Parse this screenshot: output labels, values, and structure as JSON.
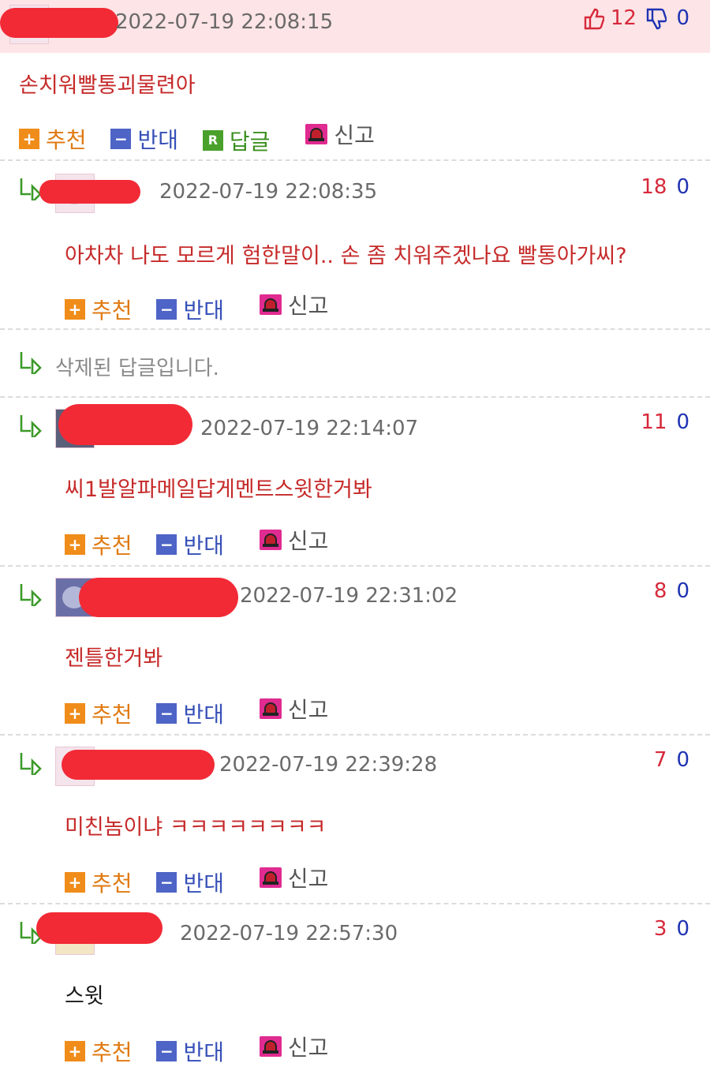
{
  "top": {
    "date": "2022-07-19 22:08:15",
    "up": "12",
    "down": "0",
    "text": "손치워빨통괴물련아",
    "actions": {
      "recommend": "추천",
      "oppose": "반대",
      "reply": "답글",
      "report": "신고"
    }
  },
  "replies": [
    {
      "date": "2022-07-19 22:08:35",
      "up": "18",
      "down": "0",
      "text": "아차차 나도 모르게 험한말이.. 손 좀 치워주겠나요 빨통아가씨?",
      "recommend": "추천",
      "oppose": "반대",
      "report": "신고"
    },
    {
      "deleted_text": "삭제된 답글입니다."
    },
    {
      "date": "2022-07-19 22:14:07",
      "up": "11",
      "down": "0",
      "text": "씨1발알파메일답게멘트스윗한거봐",
      "recommend": "추천",
      "oppose": "반대",
      "report": "신고"
    },
    {
      "date": "2022-07-19 22:31:02",
      "up": "8",
      "down": "0",
      "text": "젠틀한거봐",
      "recommend": "추천",
      "oppose": "반대",
      "report": "신고"
    },
    {
      "date": "2022-07-19 22:39:28",
      "up": "7",
      "down": "0",
      "text": "미친놈이냐 ㅋㅋㅋㅋㅋㅋㅋㅋ",
      "recommend": "추천",
      "oppose": "반대",
      "report": "신고"
    },
    {
      "date": "2022-07-19 22:57:30",
      "up": "3",
      "down": "0",
      "text": "스윗",
      "recommend": "추천",
      "oppose": "반대",
      "report": "신고"
    }
  ],
  "colors": {
    "header_bg": "#fde4e6",
    "text_red": "#c62a2a",
    "up_red": "#d6293a",
    "down_blue": "#1f33b3",
    "redaction": "#f22a36"
  }
}
